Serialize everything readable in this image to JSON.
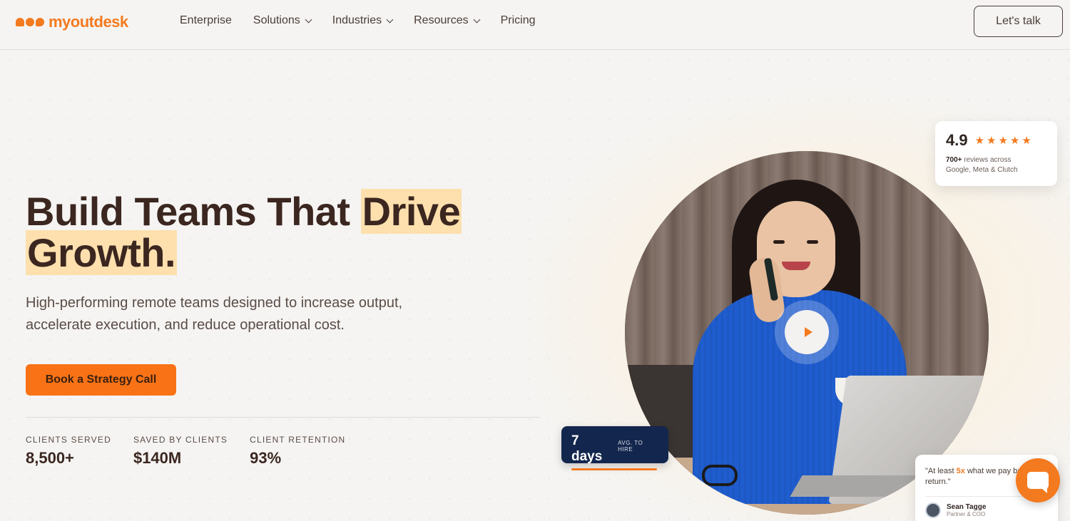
{
  "header": {
    "logo_text": "myoutdesk",
    "nav": [
      {
        "label": "Enterprise",
        "has_dropdown": false
      },
      {
        "label": "Solutions",
        "has_dropdown": true
      },
      {
        "label": "Industries",
        "has_dropdown": true
      },
      {
        "label": "Resources",
        "has_dropdown": true
      },
      {
        "label": "Pricing",
        "has_dropdown": false
      }
    ],
    "cta_label": "Let's talk"
  },
  "hero": {
    "title_part1": "Build Teams That ",
    "title_highlight1": "Drive",
    "title_highlight2": "Growth.",
    "subtitle": "High-performing remote teams designed to increase output, accelerate execution, and reduce operational cost.",
    "cta_label": "Book a Strategy Call"
  },
  "stats": [
    {
      "label": "CLIENTS SERVED",
      "value": "8,500+"
    },
    {
      "label": "SAVED BY CLIENTS",
      "value": "$140M"
    },
    {
      "label": "CLIENT RETENTION",
      "value": "93%"
    }
  ],
  "rating": {
    "score": "4.9",
    "stars": 5,
    "reviews_bold": "700+",
    "reviews_text": " reviews across",
    "sources": "Google, Meta & Clutch"
  },
  "days_badge": {
    "value": "7 days",
    "label": "AVG. TO HIRE"
  },
  "testimonial": {
    "quote_start": "\"At least ",
    "quote_bold": "5x",
    "quote_end": " what we pay back in return.\"",
    "author_name": "Sean Tagge",
    "author_role": "Partner & COO"
  },
  "colors": {
    "accent": "#f47a1f",
    "highlight": "#fde0ad",
    "navy": "#13264d",
    "text": "#3b2620"
  }
}
